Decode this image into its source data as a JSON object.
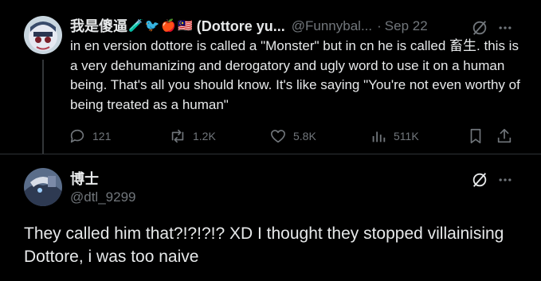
{
  "tweet1": {
    "display_name": "我是傻逼",
    "emojis": [
      "🧪",
      "🐦",
      "🍎",
      "🇲🇾"
    ],
    "display_name_suffix": "(Dottore yu...",
    "handle": "@Funnybal...",
    "separator": "·",
    "date": "Sep 22",
    "text": "in en version dottore is called a \"Monster\" but in cn he is called 畜生. this is a very dehumanizing and derogatory and ugly word to use it on a human being. That's all you should know. It's like saying \"You're not even worthy of being treated as a human\"",
    "actions": {
      "replies": "121",
      "reposts": "1.2K",
      "likes": "5.8K",
      "views": "511K"
    },
    "icons": [
      "grok-icon",
      "more-icon",
      "reply-icon",
      "repost-icon",
      "like-icon",
      "views-icon",
      "bookmark-icon",
      "share-icon"
    ]
  },
  "tweet2": {
    "display_name": "博士",
    "handle": "@dtl_9299",
    "text": "They called him that?!?!?!? XD I thought they stopped villainising Dottore, i was too naive",
    "icons": [
      "grok-icon",
      "more-icon"
    ]
  },
  "colors": {
    "background": "#000000",
    "primary_text": "#e7e9ea",
    "secondary_text": "#71767b",
    "divider": "#2f3336"
  }
}
